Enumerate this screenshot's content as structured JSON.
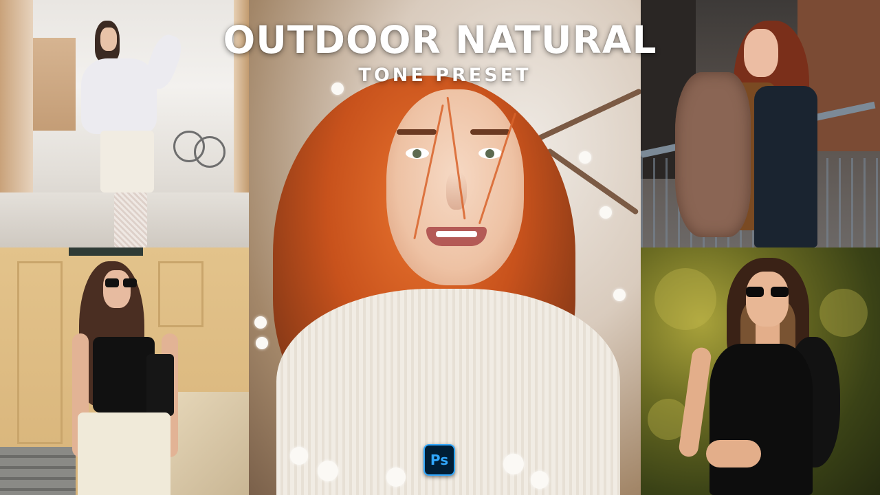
{
  "title": {
    "main": "OUTDOOR NATURAL",
    "sub": "TONE PRESET"
  },
  "badge": {
    "text": "Ps",
    "icon": "photoshop-icon",
    "background": "#001e36",
    "accent": "#31a8ff"
  },
  "photos": [
    {
      "name": "woman-white-outfit-street",
      "position": "top-left"
    },
    {
      "name": "woman-black-top-sunglasses-yellow-wall",
      "position": "bottom-left"
    },
    {
      "name": "red-haired-woman-portrait-blossoms",
      "position": "center"
    },
    {
      "name": "woman-fur-coat-railing",
      "position": "top-right"
    },
    {
      "name": "woman-black-dress-sunglasses-greenery",
      "position": "bottom-right"
    }
  ]
}
